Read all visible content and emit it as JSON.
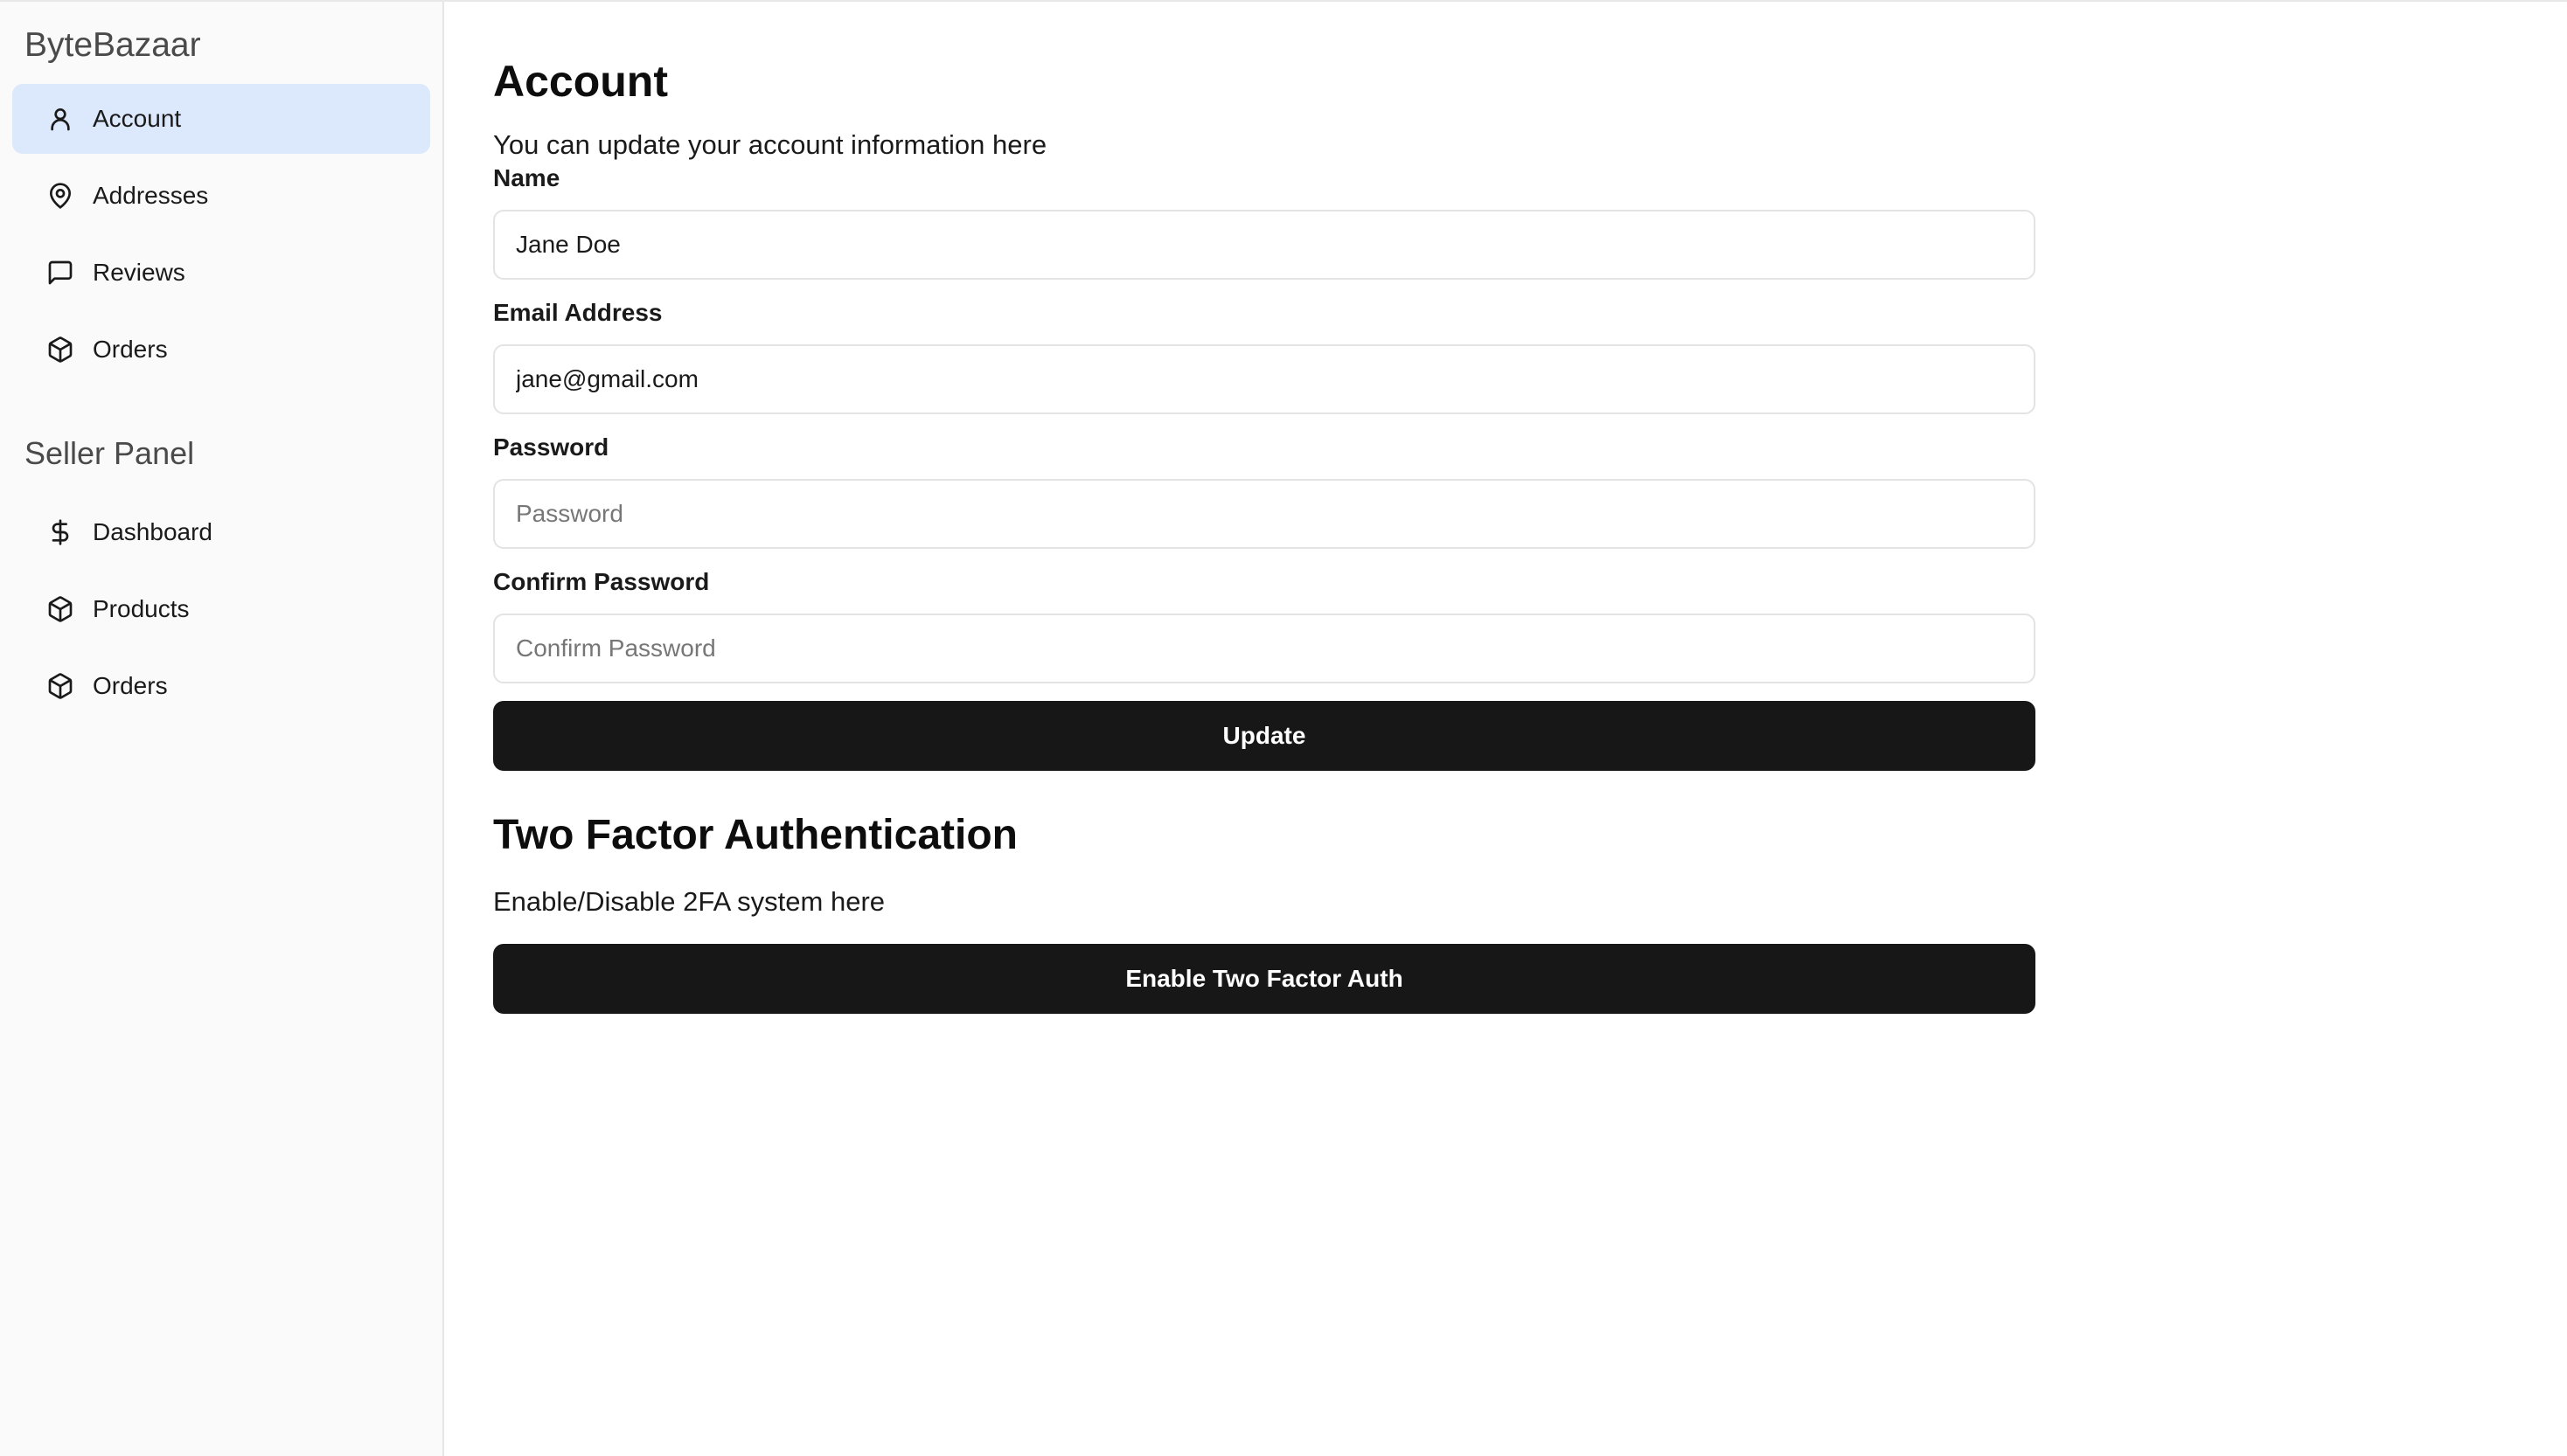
{
  "app": {
    "brand": "ByteBazaar"
  },
  "sidebar": {
    "account_items": [
      {
        "label": "Account",
        "icon": "user-icon",
        "active": true
      },
      {
        "label": "Addresses",
        "icon": "map-pin-icon",
        "active": false
      },
      {
        "label": "Reviews",
        "icon": "message-square-icon",
        "active": false
      },
      {
        "label": "Orders",
        "icon": "package-icon",
        "active": false
      }
    ],
    "seller_title": "Seller Panel",
    "seller_items": [
      {
        "label": "Dashboard",
        "icon": "dollar-sign-icon"
      },
      {
        "label": "Products",
        "icon": "package-icon"
      },
      {
        "label": "Orders",
        "icon": "package-icon"
      }
    ]
  },
  "account_form": {
    "title": "Account",
    "subtitle": "You can update your account information here",
    "name": {
      "label": "Name",
      "value": "Jane Doe"
    },
    "email": {
      "label": "Email Address",
      "value": "jane@gmail.com"
    },
    "password": {
      "label": "Password",
      "placeholder": "Password"
    },
    "confirm_password": {
      "label": "Confirm Password",
      "placeholder": "Confirm Password"
    },
    "update_label": "Update"
  },
  "two_factor": {
    "title": "Two Factor Authentication",
    "description": "Enable/Disable 2FA system here",
    "button_label": "Enable Two Factor Auth"
  },
  "colors": {
    "active_nav_bg": "#dce8fb",
    "button_bg": "#171717",
    "sidebar_bg": "#fafafa"
  }
}
